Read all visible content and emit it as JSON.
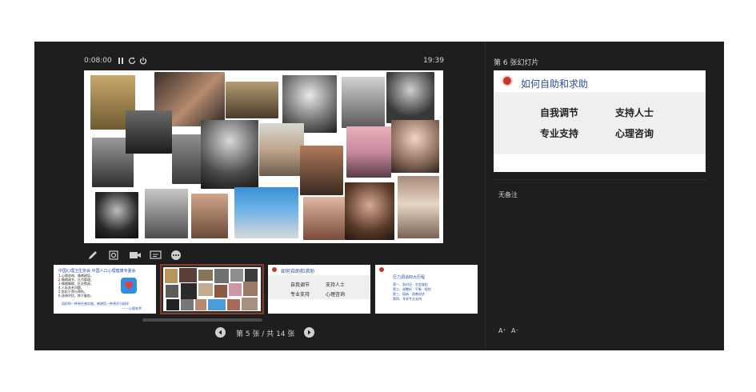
{
  "header": {
    "elapsed_time": "0:08:00",
    "clock": "19:39"
  },
  "controls": [
    "pause-icon",
    "restart-icon",
    "power-icon"
  ],
  "tools": [
    "pen-icon",
    "zoom-icon",
    "camera-icon",
    "subtitle-icon",
    "more-icon"
  ],
  "thumbnails": [
    {
      "title": "中国心理卫生协会  中国人口心理健康专委会",
      "lines": [
        "1.心理咨询、情绪疏导。",
        "2.情绪调节、压力管理。",
        "3.情绪障碍、社交焦虑。",
        "4.人际关系问题。",
        "5.危机干预与预防。",
        "6.咨询评估、转介服务。"
      ],
      "footer": "组织的一种责任感实施，感谢您一种责任与陪伴",
      "footer2": "——心理老师"
    },
    {
      "title": ""
    },
    {
      "title": "如何自助和求助",
      "items": [
        "自我调节",
        "支持人士",
        "专业支持",
        "心理咨询"
      ]
    },
    {
      "title": "压力调适四大历程",
      "lines": [
        "第一、面对压 · 学会放松",
        "第二、调整好 · 平衡 · 规划",
        "第三、接纳 · 改善现状",
        "第四、寻求专业支持"
      ]
    }
  ],
  "navigation": {
    "label": "第 5 张 / 共 14 张"
  },
  "next_slide": {
    "label": "第 6 张幻灯片",
    "title": "如何自助和求助",
    "items": [
      "自我调节",
      "支持人士",
      "专业支持",
      "心理咨询"
    ]
  },
  "notes": {
    "text": "无备注"
  },
  "font_controls": {
    "increase": "A⁺",
    "decrease": "A⁻"
  },
  "colors": {
    "background": "#1e1e1e",
    "accent_title": "#2e4f8f",
    "selected_thumb": "#8a3b2a"
  }
}
